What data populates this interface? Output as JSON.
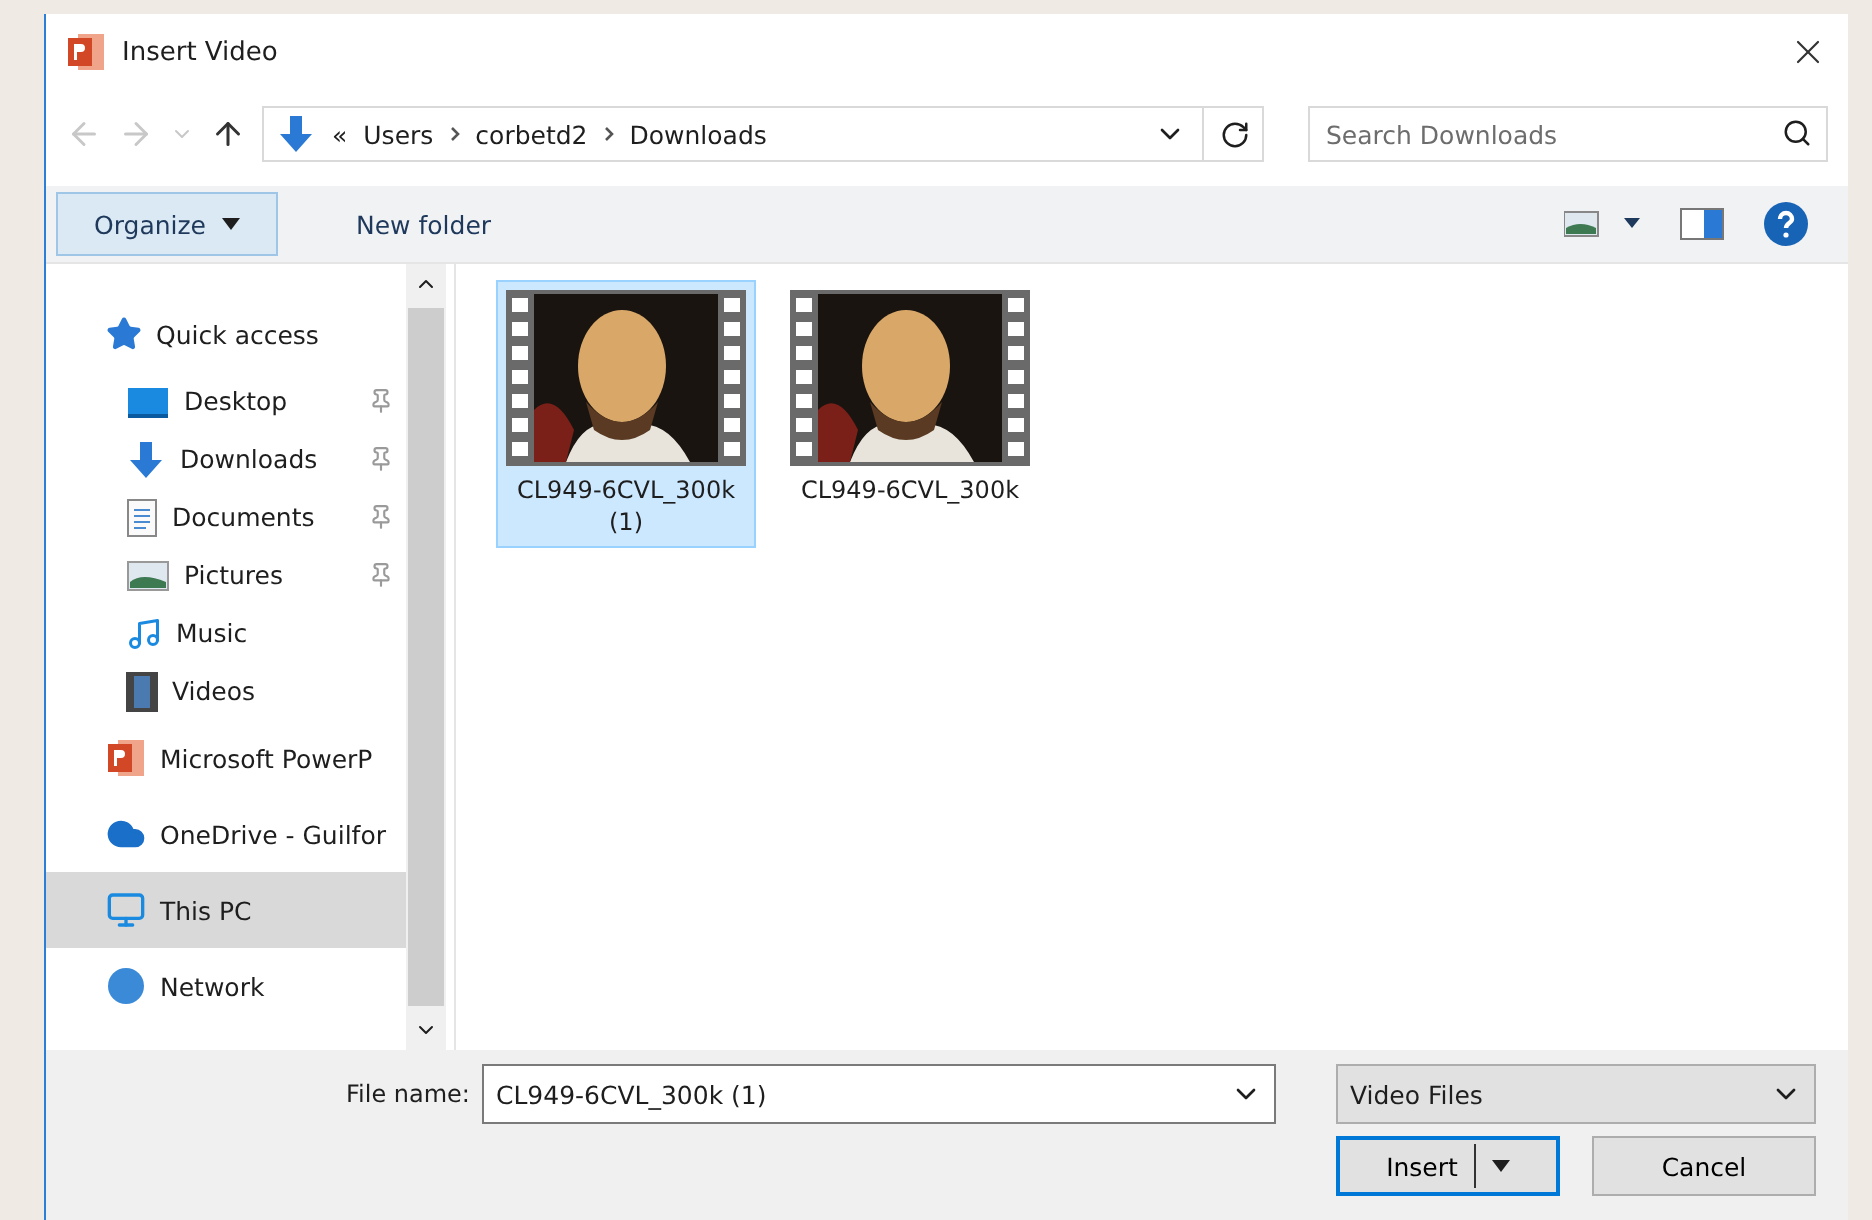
{
  "window": {
    "title": "Insert Video"
  },
  "address": {
    "overflow": "«",
    "crumbs": [
      "Users",
      "corbetd2",
      "Downloads"
    ]
  },
  "search": {
    "placeholder": "Search Downloads"
  },
  "toolbar": {
    "buttons": [
      "Organize",
      "New folder"
    ]
  },
  "sidebar": {
    "items": [
      {
        "label": "Quick access",
        "kind": "star",
        "pinned": false,
        "selected": false,
        "children": [
          {
            "label": "Desktop",
            "kind": "desktop",
            "pinned": true,
            "selected": false
          },
          {
            "label": "Downloads",
            "kind": "download",
            "pinned": true,
            "selected": false
          },
          {
            "label": "Documents",
            "kind": "document",
            "pinned": true,
            "selected": false
          },
          {
            "label": "Pictures",
            "kind": "pictures",
            "pinned": true,
            "selected": false
          },
          {
            "label": "Music",
            "kind": "music",
            "pinned": false,
            "selected": false
          },
          {
            "label": "Videos",
            "kind": "videos",
            "pinned": false,
            "selected": false
          }
        ]
      },
      {
        "label": "Microsoft PowerP",
        "kind": "powerpoint",
        "pinned": false,
        "selected": false
      },
      {
        "label": "OneDrive - Guilfor",
        "kind": "cloud",
        "pinned": false,
        "selected": false
      },
      {
        "label": "This PC",
        "kind": "pc",
        "pinned": false,
        "selected": true
      },
      {
        "label": "Network",
        "kind": "network",
        "pinned": false,
        "selected": false
      }
    ]
  },
  "files": [
    {
      "name": "CL949-6CVL_300k (1)",
      "selected": true,
      "kind": "picture"
    },
    {
      "name": "CL949-6CVL_300k",
      "selected": false,
      "kind": "picture"
    }
  ],
  "footer": {
    "file_name_label": "File name:",
    "file_name": "CL949-6CVL_300k (1)",
    "file_type": "Video Files",
    "buttons": [
      "Insert",
      "Cancel"
    ]
  }
}
